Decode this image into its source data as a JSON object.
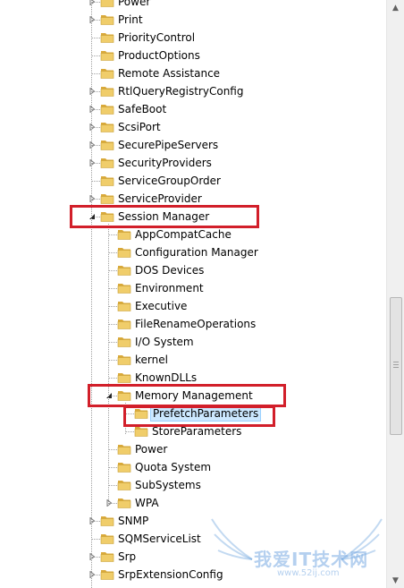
{
  "tree": {
    "items": [
      {
        "label": "Power",
        "level": 0,
        "expander": "collapsed"
      },
      {
        "label": "Print",
        "level": 0,
        "expander": "collapsed"
      },
      {
        "label": "PriorityControl",
        "level": 0,
        "expander": "none"
      },
      {
        "label": "ProductOptions",
        "level": 0,
        "expander": "none"
      },
      {
        "label": "Remote Assistance",
        "level": 0,
        "expander": "none"
      },
      {
        "label": "RtlQueryRegistryConfig",
        "level": 0,
        "expander": "collapsed"
      },
      {
        "label": "SafeBoot",
        "level": 0,
        "expander": "collapsed"
      },
      {
        "label": "ScsiPort",
        "level": 0,
        "expander": "collapsed"
      },
      {
        "label": "SecurePipeServers",
        "level": 0,
        "expander": "collapsed"
      },
      {
        "label": "SecurityProviders",
        "level": 0,
        "expander": "collapsed"
      },
      {
        "label": "ServiceGroupOrder",
        "level": 0,
        "expander": "none"
      },
      {
        "label": "ServiceProvider",
        "level": 0,
        "expander": "collapsed"
      },
      {
        "label": "Session Manager",
        "level": 0,
        "expander": "expanded"
      },
      {
        "label": "AppCompatCache",
        "level": 1,
        "expander": "none"
      },
      {
        "label": "Configuration Manager",
        "level": 1,
        "expander": "none"
      },
      {
        "label": "DOS Devices",
        "level": 1,
        "expander": "none"
      },
      {
        "label": "Environment",
        "level": 1,
        "expander": "none"
      },
      {
        "label": "Executive",
        "level": 1,
        "expander": "none"
      },
      {
        "label": "FileRenameOperations",
        "level": 1,
        "expander": "none"
      },
      {
        "label": "I/O System",
        "level": 1,
        "expander": "none"
      },
      {
        "label": "kernel",
        "level": 1,
        "expander": "none"
      },
      {
        "label": "KnownDLLs",
        "level": 1,
        "expander": "none"
      },
      {
        "label": "Memory Management",
        "level": 1,
        "expander": "expanded"
      },
      {
        "label": "PrefetchParameters",
        "level": 2,
        "expander": "none",
        "selected": true
      },
      {
        "label": "StoreParameters",
        "level": 2,
        "expander": "none"
      },
      {
        "label": "Power",
        "level": 1,
        "expander": "none"
      },
      {
        "label": "Quota System",
        "level": 1,
        "expander": "none"
      },
      {
        "label": "SubSystems",
        "level": 1,
        "expander": "none"
      },
      {
        "label": "WPA",
        "level": 1,
        "expander": "collapsed"
      },
      {
        "label": "SNMP",
        "level": 0,
        "expander": "collapsed"
      },
      {
        "label": "SQMServiceList",
        "level": 0,
        "expander": "none"
      },
      {
        "label": "Srp",
        "level": 0,
        "expander": "collapsed"
      },
      {
        "label": "SrpExtensionConfig",
        "level": 0,
        "expander": "collapsed"
      }
    ]
  },
  "watermark": {
    "text": "我爱IT技术网",
    "url": "www.52ij.com"
  },
  "colors": {
    "highlight_box": "#d21f2a",
    "selection_bg": "#cce8ff",
    "folder_body": "#e8c15a",
    "folder_tab": "#d9a93a"
  },
  "icons": {
    "folder": "folder-icon",
    "collapsed": "expand-arrow-icon",
    "expanded": "collapse-arrow-icon"
  }
}
